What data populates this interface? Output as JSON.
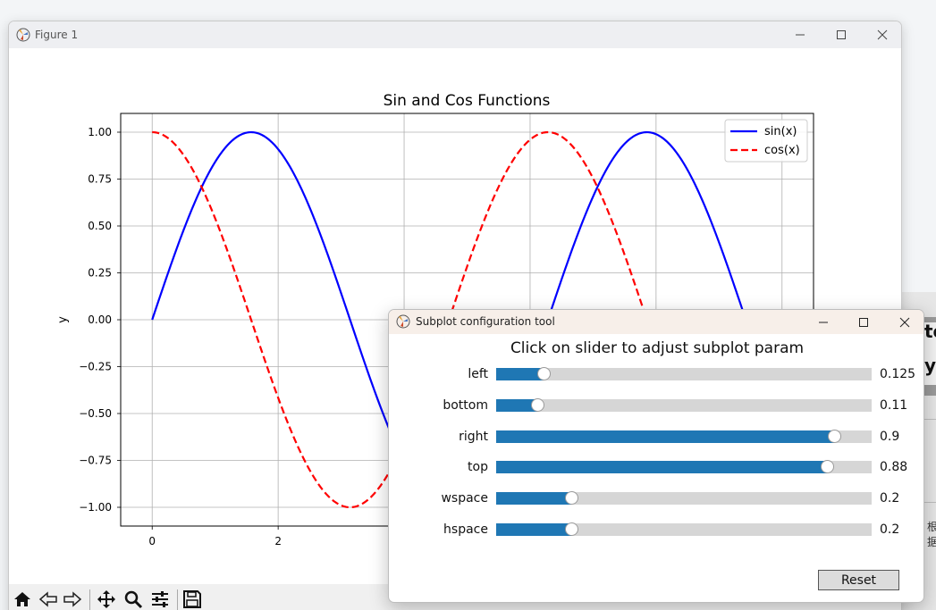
{
  "figure_window": {
    "title": "Figure 1",
    "icon": "matplotlib-icon"
  },
  "toolbar": {
    "buttons": [
      "home-icon",
      "back-icon",
      "forward-icon",
      "pan-icon",
      "zoom-icon",
      "configure-subplots-icon",
      "save-icon"
    ]
  },
  "chart_data": {
    "type": "line",
    "title": "Sin and Cos Functions",
    "xlabel": "",
    "ylabel": "y",
    "xlim": [
      -0.5,
      10.5
    ],
    "ylim": [
      -1.1,
      1.1
    ],
    "x_ticks": [
      0,
      2
    ],
    "x_tick_labels": [
      "0",
      "2"
    ],
    "y_ticks": [
      1.0,
      0.75,
      0.5,
      0.25,
      0.0,
      -0.25,
      -0.5,
      -0.75,
      -1.0
    ],
    "y_tick_labels": [
      "1.00",
      "0.75",
      "0.50",
      "0.25",
      "0.00",
      "−0.25",
      "−0.50",
      "−0.75",
      "−1.00"
    ],
    "grid": true,
    "legend_position": "upper right",
    "series": [
      {
        "name": "sin(x)",
        "function": "sin",
        "x_range": [
          0,
          10
        ],
        "color": "#0000ff",
        "linestyle": "solid"
      },
      {
        "name": "cos(x)",
        "function": "cos",
        "x_range": [
          0,
          10
        ],
        "color": "#ff0000",
        "linestyle": "dashed"
      }
    ]
  },
  "config_dialog": {
    "title": "Subplot configuration tool",
    "heading": "Click on slider to adjust subplot param",
    "sliders": [
      {
        "label": "left",
        "value": "0.125",
        "fraction": 0.125
      },
      {
        "label": "bottom",
        "value": "0.11",
        "fraction": 0.11
      },
      {
        "label": "right",
        "value": "0.9",
        "fraction": 0.9
      },
      {
        "label": "top",
        "value": "0.88",
        "fraction": 0.88
      },
      {
        "label": "wspace",
        "value": "0.2",
        "fraction": 0.2
      },
      {
        "label": "hspace",
        "value": "0.2",
        "fraction": 0.2
      }
    ],
    "reset_label": "Reset",
    "accent_color": "#1f77b4"
  },
  "background_window": {
    "text_fragments": [
      "to",
      "y",
      "根据"
    ]
  }
}
